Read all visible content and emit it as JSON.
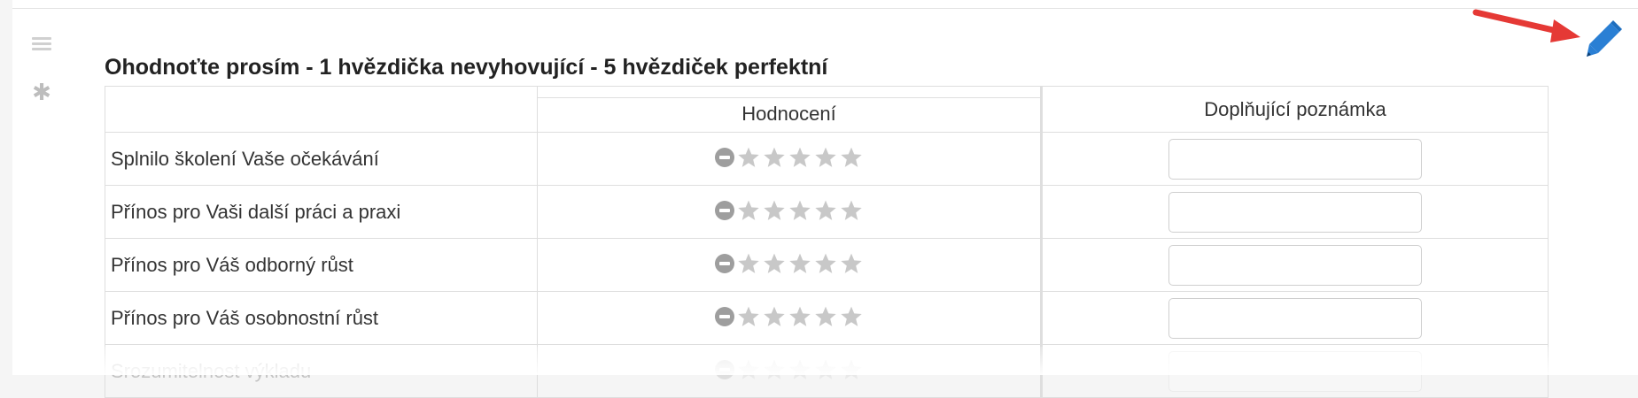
{
  "question": {
    "title": "Ohodnoťte prosím - 1 hvězdička nevyhovující - 5 hvězdiček perfektní",
    "columns": {
      "rating": "Hodnocení",
      "note": "Doplňující poznámka"
    },
    "rows": [
      {
        "label": "Splnilo školení Vaše očekávání",
        "stars_selected": 0,
        "stars_max": 5,
        "note_value": ""
      },
      {
        "label": "Přínos pro Vaši další práci a praxi",
        "stars_selected": 0,
        "stars_max": 5,
        "note_value": ""
      },
      {
        "label": "Přínos pro Váš odborný růst",
        "stars_selected": 0,
        "stars_max": 5,
        "note_value": ""
      },
      {
        "label": "Přínos pro Váš osobnostní růst",
        "stars_selected": 0,
        "stars_max": 5,
        "note_value": ""
      },
      {
        "label": "Srozumitelnost výkladu",
        "stars_selected": 0,
        "stars_max": 5,
        "note_value": ""
      }
    ]
  },
  "icons": {
    "drag": "drag-handle-icon",
    "required": "asterisk-icon",
    "edit": "pencil-icon",
    "annotation": "red-arrow-icon",
    "cancel": "minus-circle-icon",
    "star": "star-icon"
  },
  "colors": {
    "pen": "#2a7fd4",
    "arrow": "#e53935",
    "star_empty": "#c8c8c8",
    "cancel": "#9e9e9e"
  }
}
